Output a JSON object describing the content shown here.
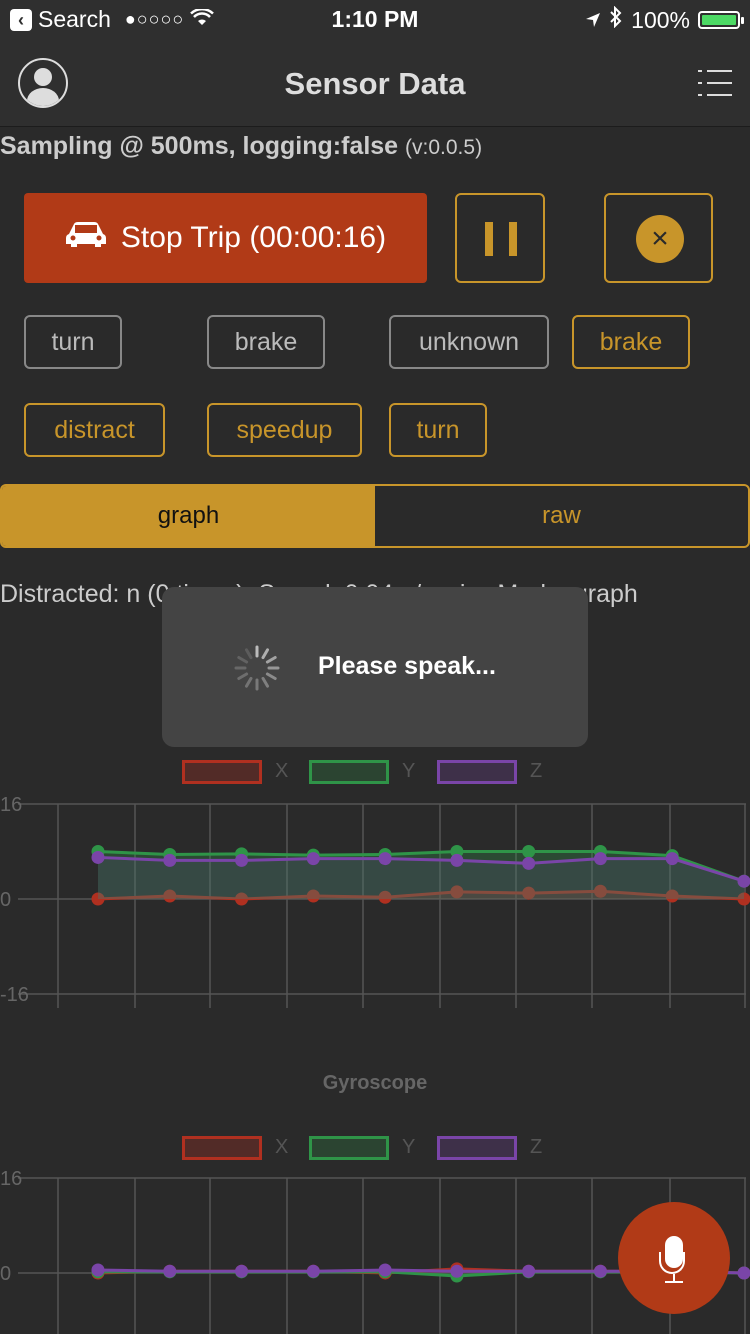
{
  "status_bar": {
    "back_label": "Search",
    "signal": "●○○○○",
    "time": "1:10 PM",
    "battery": "100%"
  },
  "nav": {
    "title": "Sensor Data"
  },
  "subtitle": {
    "text": "Sampling @ 500ms, logging:false",
    "version": "(v:0.0.5)"
  },
  "controls": {
    "stop_trip_label": "Stop Trip (00:00:16)"
  },
  "tags": [
    {
      "label": "turn",
      "active": false
    },
    {
      "label": "brake",
      "active": false
    },
    {
      "label": "unknown",
      "active": false
    },
    {
      "label": "brake",
      "active": true
    },
    {
      "label": "distract",
      "active": true
    },
    {
      "label": "speedup",
      "active": true
    },
    {
      "label": "turn",
      "active": true
    }
  ],
  "segmented": {
    "graph": "graph",
    "raw": "raw",
    "selected": "graph"
  },
  "info_line": "Distracted: n   (0 times), Speed: 0.04m/s, viewMode: graph",
  "toast": {
    "message": "Please speak..."
  },
  "colors": {
    "accent": "#c8952a",
    "danger": "#b13a17",
    "x_series": "#b03020",
    "y_series": "#2f9448",
    "z_series": "#7a45a8"
  },
  "chart_data": [
    {
      "type": "line",
      "title": "",
      "legend": [
        "X",
        "Y",
        "Z"
      ],
      "yticks": [
        "16",
        "0",
        "-16"
      ],
      "ylim": [
        -16,
        16
      ],
      "grid": true,
      "series": [
        {
          "name": "X",
          "values": [
            0,
            0.5,
            0,
            0.5,
            0.3,
            1.2,
            1,
            1.3,
            0.5,
            0
          ]
        },
        {
          "name": "Y",
          "values": [
            8,
            7.5,
            7.6,
            7.4,
            7.5,
            8,
            8,
            8,
            7.3,
            3
          ]
        },
        {
          "name": "Z",
          "values": [
            7,
            6.5,
            6.5,
            6.8,
            6.8,
            6.5,
            6,
            6.8,
            6.8,
            3
          ]
        }
      ]
    },
    {
      "type": "line",
      "title": "Gyroscope",
      "legend": [
        "X",
        "Y",
        "Z"
      ],
      "yticks": [
        "16",
        "0"
      ],
      "ylim": [
        -16,
        16
      ],
      "grid": true,
      "series": [
        {
          "name": "X",
          "values": [
            0,
            0.3,
            0.3,
            0.3,
            0,
            0.7,
            0.3,
            0.3,
            0.3,
            0
          ]
        },
        {
          "name": "Y",
          "values": [
            0.2,
            0.2,
            0.2,
            0.2,
            0.2,
            -0.5,
            0.2,
            0.2,
            0.2,
            0
          ]
        },
        {
          "name": "Z",
          "values": [
            0.5,
            0.3,
            0.3,
            0.3,
            0.5,
            0.3,
            0.3,
            0.3,
            0.3,
            0
          ]
        }
      ]
    }
  ]
}
